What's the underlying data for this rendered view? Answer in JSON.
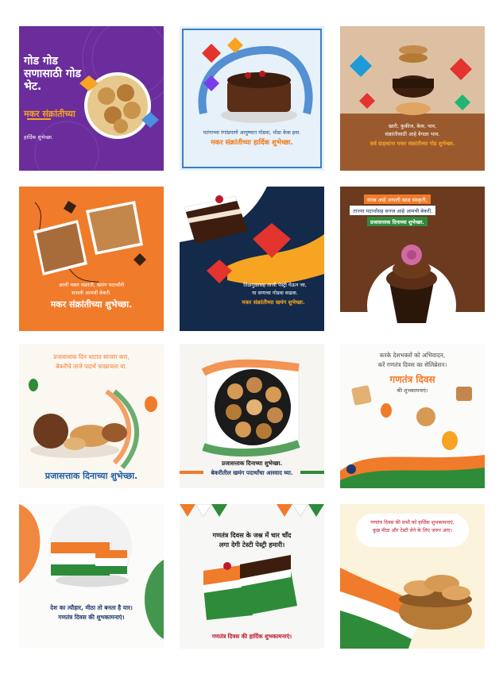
{
  "cards": [
    {
      "headline": "गोड गोड सणासाठी गोड भेट.",
      "title": "मकर संक्रांतीच्या",
      "subtitle": "हार्दिक शुभेच्छा."
    },
    {
      "line1": "पतंगाच्या रंगांप्रमाणे आयुष्यात गोडवा, थोडा केक हवा.",
      "title": "मकर संक्रांतीच्या हार्दिक शुभेच्छा."
    },
    {
      "line1": "खारी, कुकीज, केक, पाव,",
      "line2": "संक्रांतीसाठी आहे वेगळा भाव.",
      "title": "सर्व ग्राहकांना मकर संक्रांतीच्या गोड शुभेच्छा."
    },
    {
      "line1": "आली मकर संक्रांती, खमंग पदार्थांनी",
      "line2": "सजली आमची बेकरी.",
      "title": "मकर संक्रांतीच्या शुभेच्छा."
    },
    {
      "line1": "तिळगुळासह ताजी पेस्ट्री घेऊन जा,",
      "line2": "या सणाचा गोडवा वाढवा.",
      "title": "मकर संक्रांतीच्या खमंग शुभेच्छा."
    },
    {
      "line1": "संपन्न आहे आपली खाद्य संस्कृती,",
      "line2": "ताज्या पदार्थांसह सज्ज आहे आमची बेकरी.",
      "title": "प्रजासत्ताक दिनाच्या शुभेच्छा."
    },
    {
      "line1": "प्रजासत्ताक दिन थाटात साजरा करा,",
      "line2": "बेकरीचे ताजे पदार्थ चाखायला या.",
      "title": "प्रजासत्ताक दिनाच्या शुभेच्छा."
    },
    {
      "line1": "प्रजासत्ताक दिनाच्या शुभेच्छा.",
      "line2": "बेकरीतील खमंग पदार्थांचा आस्वाद घ्या."
    },
    {
      "line1": "करके देशभक्तों को अभिवादन,",
      "line2": "करें गणतंत्र दिवस का सेलिब्रेशन।",
      "title": "गणतंत्र दिवस",
      "subtitle": "की शुभकामनाएं।"
    },
    {
      "line1": "देश का त्यौहार, मीठा तो बनता है यार।",
      "line2": "गणतंत्र दिवस की शुभकामनाएं।"
    },
    {
      "line1": "गणतंत्र दिवस के जश्न में चार चाँद",
      "line2": "लगा देगी टेस्टी पेस्ट्री हमारी।",
      "title": "गणतंत्र दिवस की हार्दिक शुभकामनाएं।"
    },
    {
      "line1": "गणतंत्र दिवस की सभी को हार्दिक शुभकामनाएं,",
      "line2": "कुछ मीठा और टेस्टी लेने के लिए जरूर आए।"
    }
  ]
}
